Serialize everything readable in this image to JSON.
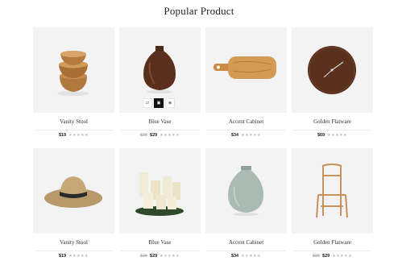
{
  "page": {
    "title": "Popular Product"
  },
  "rows": [
    [
      {
        "name": "Vanity Stool",
        "old_price": "",
        "price": "$19",
        "image": "wooden-bowls"
      },
      {
        "name": "Blue Vase",
        "old_price": "$35",
        "price": "$29",
        "image": "dark-vase"
      },
      {
        "name": "Accent Cabinet",
        "old_price": "",
        "price": "$34",
        "image": "cutting-board"
      },
      {
        "name": "Golden Flatware",
        "old_price": "",
        "price": "$69",
        "image": "wall-clock"
      }
    ],
    [
      {
        "name": "Vanity Stool",
        "old_price": "",
        "price": "$19",
        "image": "straw-hat"
      },
      {
        "name": "Blue Vase",
        "old_price": "$35",
        "price": "$29",
        "image": "candles"
      },
      {
        "name": "Accent Cabinet",
        "old_price": "",
        "price": "$34",
        "image": "celadon-vase"
      },
      {
        "name": "Golden Flatware",
        "old_price": "$35",
        "price": "$29",
        "image": "wooden-chair"
      }
    ]
  ],
  "rating_stars": "★★★★★",
  "quick_actions": [
    {
      "icon": "compare-icon",
      "glyph": "⇄"
    },
    {
      "icon": "cart-icon",
      "glyph": "▣"
    },
    {
      "icon": "eye-icon",
      "glyph": "◉"
    }
  ],
  "colors": {
    "thumb_bg": "#f3f3f3",
    "active_action": "#111111"
  }
}
